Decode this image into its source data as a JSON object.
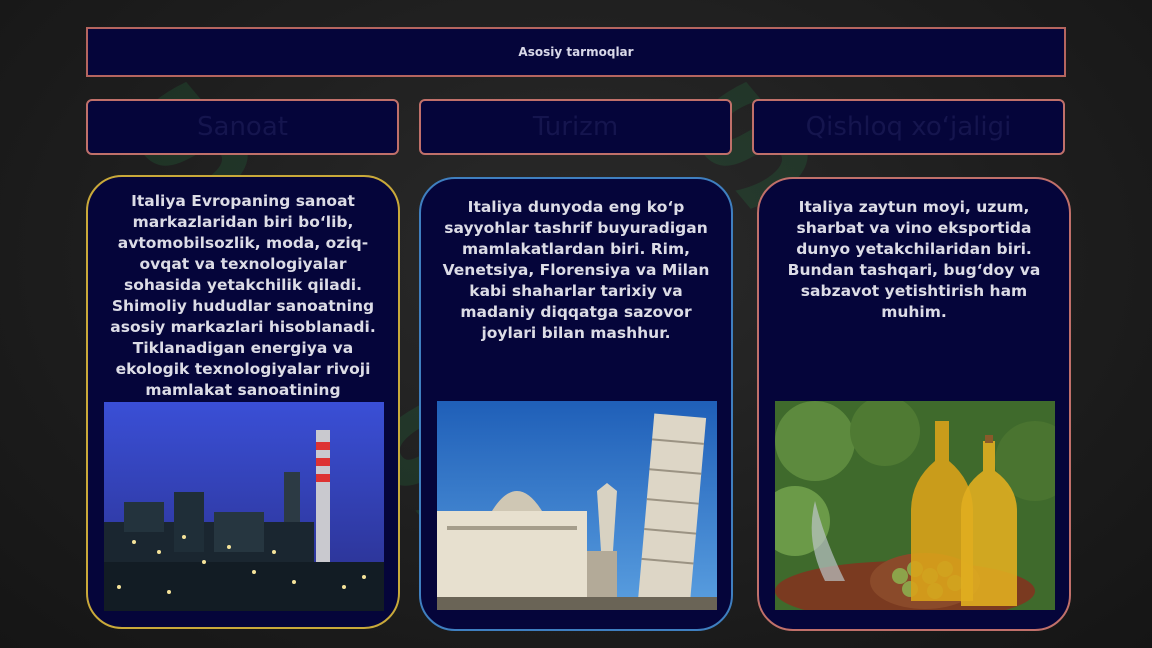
{
  "title": "Asosiy tarmoqlar",
  "categories": [
    {
      "label": "Sanoat"
    },
    {
      "label": "Turizm"
    },
    {
      "label": "Qishloq xo‘jaligi"
    }
  ],
  "cards": [
    {
      "text": "Italiya Evropaning sanoat markazlaridan biri bo‘lib, avtomobilsozlik, moda, oziq-ovqat va texnologiyalar sohasida yetakchilik qiladi. Shimoliy hududlar sanoatning asosiy markazlari hisoblanadi. Tiklanadigan energiya va ekologik texnologiyalar rivoji mamlakat sanoatining",
      "image": "industrial-plant-night",
      "border": "#c9a93a"
    },
    {
      "text": "Italiya dunyoda eng ko‘p sayyohlar tashrif buyuradigan mamlakatlardan biri. Rim, Venetsiya, Florensiya va Milan kabi shaharlar tarixiy va madaniy diqqatga sazovor joylari bilan mashhur.",
      "image": "pisa-tower-cathedral",
      "border": "#3f7fc0"
    },
    {
      "text": "Italiya zaytun moyi, uzum, sharbat va vino eksportida dunyo yetakchilaridan biri. Bundan tashqari, bug‘doy va sabzavot yetishtirish ham muhim.",
      "image": "olive-oil-bottles",
      "border": "#c0706a"
    }
  ]
}
